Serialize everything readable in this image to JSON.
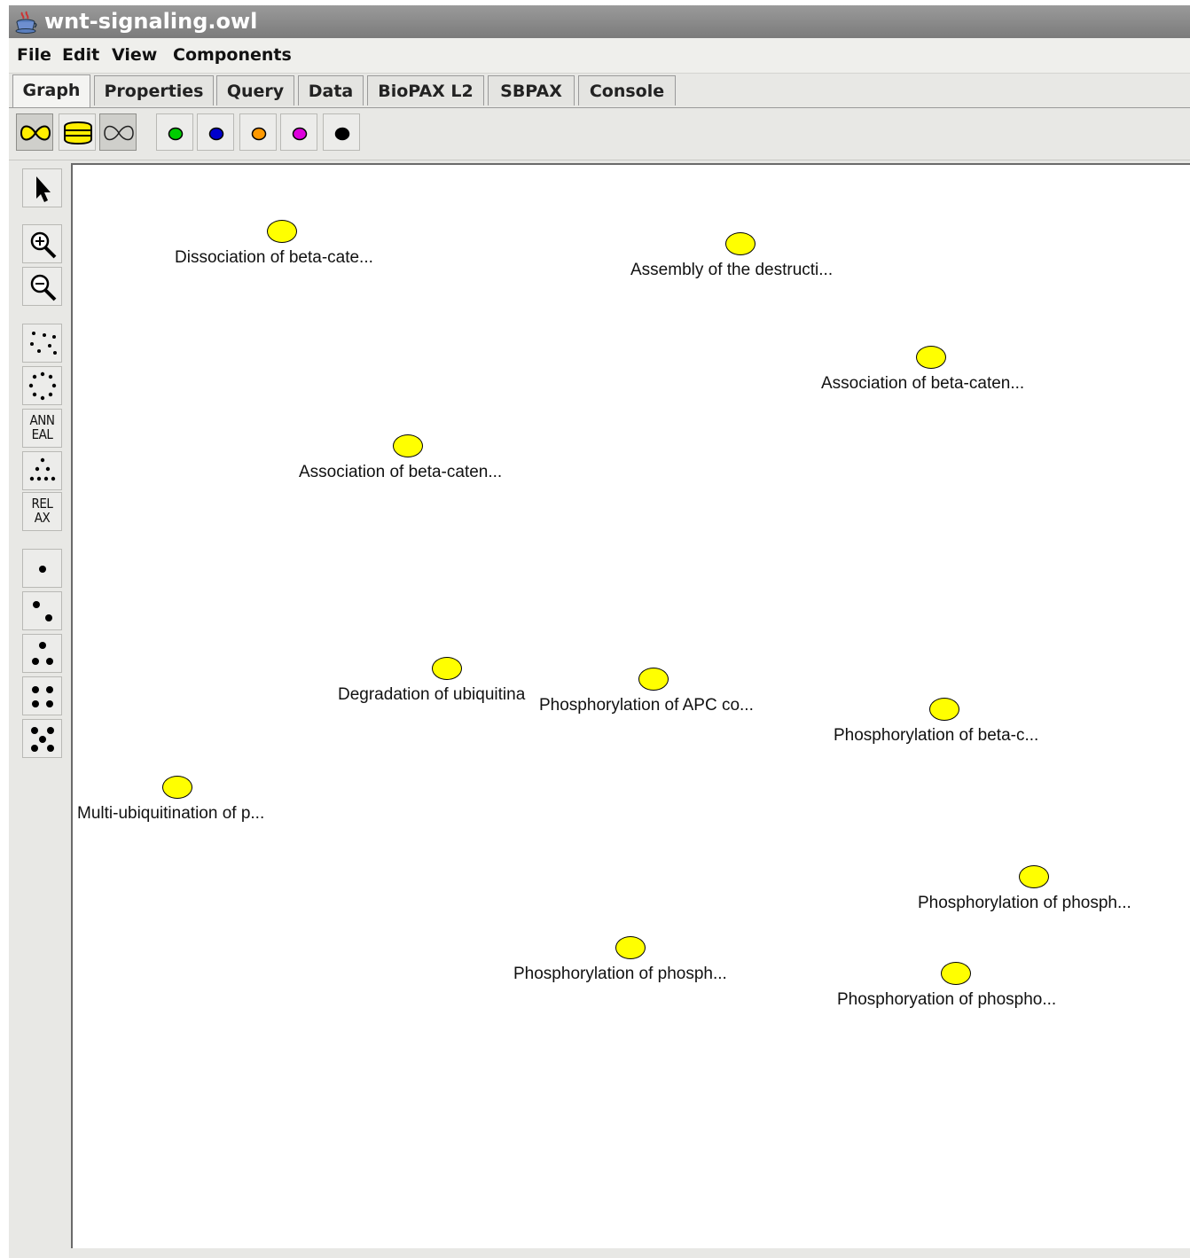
{
  "window": {
    "title": "wnt-signaling.owl"
  },
  "menu": [
    "File",
    "Edit",
    "View",
    "Components"
  ],
  "tabs": [
    {
      "label": "Graph",
      "active": true
    },
    {
      "label": "Properties",
      "active": false
    },
    {
      "label": "Query",
      "active": false
    },
    {
      "label": "Data",
      "active": false
    },
    {
      "label": "BioPAX L2",
      "active": false
    },
    {
      "label": "SBPAX",
      "active": false
    },
    {
      "label": "Console",
      "active": false
    }
  ],
  "toolbar": {
    "edge_style_buttons": [
      "curved-edges-icon",
      "straight-edges-icon",
      "no-fill-edges-icon"
    ],
    "color_buttons": [
      {
        "name": "green",
        "color": "#00cc00"
      },
      {
        "name": "blue",
        "color": "#0000cc"
      },
      {
        "name": "orange",
        "color": "#ff9900"
      },
      {
        "name": "magenta",
        "color": "#dd00dd"
      },
      {
        "name": "black",
        "color": "#000000"
      }
    ]
  },
  "sidebar": {
    "tools": [
      {
        "icon": "pointer-icon"
      },
      {
        "icon": "zoom-in-icon"
      },
      {
        "icon": "zoom-out-icon"
      },
      {
        "icon": "random-layout-icon"
      },
      {
        "icon": "circle-layout-icon"
      },
      {
        "icon": "anneal-layout-icon",
        "label_line1": "ANN",
        "label_line2": "EAL"
      },
      {
        "icon": "tree-layout-icon"
      },
      {
        "icon": "relax-layout-icon",
        "label_line1": "REL",
        "label_line2": "AX"
      },
      {
        "icon": "dice-1-icon"
      },
      {
        "icon": "dice-2-icon"
      },
      {
        "icon": "dice-3-icon"
      },
      {
        "icon": "dice-4-icon"
      },
      {
        "icon": "dice-5-icon"
      }
    ]
  },
  "graph": {
    "node_color": "#ffff00",
    "nodes": [
      {
        "label": "Dissociation of beta-cate..."
      },
      {
        "label": "Assembly of the destructi..."
      },
      {
        "label": "Association of beta-caten..."
      },
      {
        "label": "Association of beta-caten..."
      },
      {
        "label": "Degradation of ubiquitina"
      },
      {
        "label": "Phosphorylation of APC co..."
      },
      {
        "label": "Phosphorylation of beta-c..."
      },
      {
        "label": "Multi-ubiquitination of p..."
      },
      {
        "label": "Phosphorylation of phosph..."
      },
      {
        "label": "Phosphorylation of phosph..."
      },
      {
        "label": "Phosphoryation of phospho..."
      }
    ]
  }
}
